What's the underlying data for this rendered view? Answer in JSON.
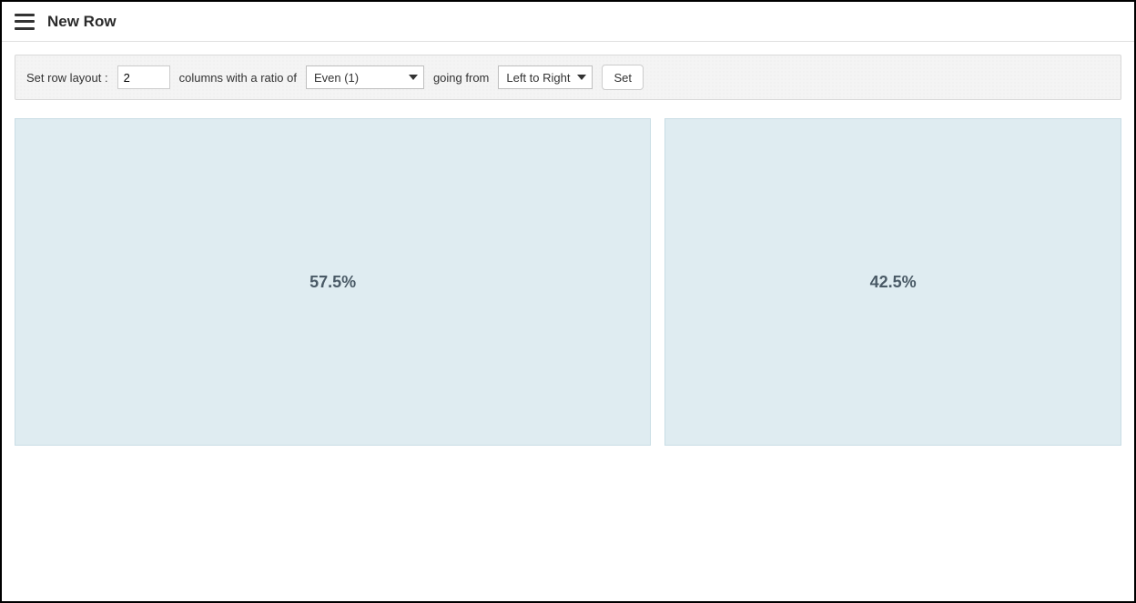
{
  "header": {
    "title": "New Row"
  },
  "layoutBar": {
    "setLabel": "Set row layout :",
    "columnsValue": "2",
    "columnsSuffix": "columns with a ratio of",
    "ratioSelected": "Even (1)",
    "goingFromLabel": "going from",
    "directionSelected": "Left to Right",
    "setButton": "Set"
  },
  "preview": {
    "leftPercent": "57.5%",
    "rightPercent": "42.5%"
  }
}
